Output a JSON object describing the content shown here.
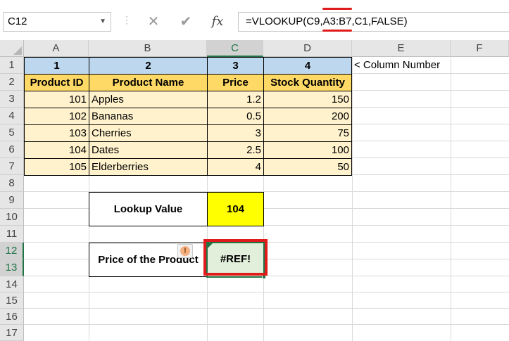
{
  "name_box": {
    "value": "C12"
  },
  "formula_bar": {
    "cancel_icon": "close-icon",
    "enter_icon": "checkmark-icon",
    "fx_label": "fx",
    "formula": "=VLOOKUP(C9,A3:B7,C1,FALSE)"
  },
  "columns": [
    "A",
    "B",
    "C",
    "D",
    "E",
    "F"
  ],
  "rows": [
    "1",
    "2",
    "3",
    "4",
    "5",
    "6",
    "7",
    "8",
    "9",
    "10",
    "11",
    "12",
    "13",
    "14",
    "15",
    "16",
    "17"
  ],
  "sheet": {
    "col_numbers": [
      "1",
      "2",
      "3",
      "4"
    ],
    "col_number_note": "< Column Number",
    "headers": [
      "Product ID",
      "Product Name",
      "Price",
      "Stock Quantity"
    ],
    "data": [
      [
        "101",
        "Apples",
        "1.2",
        "150"
      ],
      [
        "102",
        "Bananas",
        "0.5",
        "200"
      ],
      [
        "103",
        "Cherries",
        "3",
        "75"
      ],
      [
        "104",
        "Dates",
        "2.5",
        "100"
      ],
      [
        "105",
        "Elderberries",
        "4",
        "50"
      ]
    ],
    "lookup_label": "Lookup Value",
    "lookup_value": "104",
    "result_label": "Price of the Product",
    "result_value": "#REF!"
  },
  "colors": {
    "header_blue": "#bdd7ee",
    "header_gold": "#ffd966",
    "data_cream": "#fff2cc",
    "lookup_yellow": "#ffff00",
    "result_green": "#e2efda",
    "highlight_red": "#e01b1b",
    "excel_green": "#217346"
  }
}
